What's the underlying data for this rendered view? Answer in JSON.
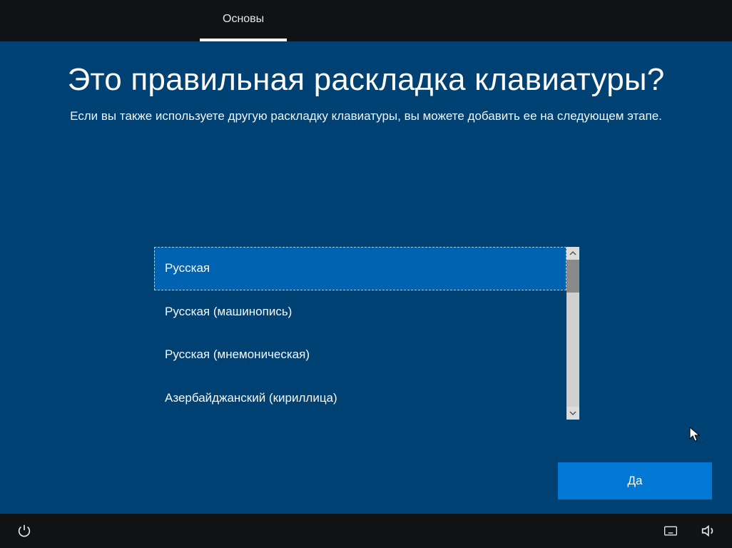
{
  "header": {
    "tab_label": "Основы"
  },
  "main": {
    "title": "Это правильная раскладка клавиатуры?",
    "subtitle": "Если вы также используете другую раскладку клавиатуры, вы можете добавить ее на следующем этапе."
  },
  "keyboard_list": {
    "items": [
      {
        "label": "Русская",
        "selected": true
      },
      {
        "label": "Русская (машинопись)",
        "selected": false
      },
      {
        "label": "Русская (мнемоническая)",
        "selected": false
      },
      {
        "label": "Азербайджанский (кириллица)",
        "selected": false
      }
    ]
  },
  "actions": {
    "confirm_label": "Да"
  },
  "icons": {
    "power": "power-icon",
    "keyboard": "keyboard-icon",
    "sound": "sound-icon"
  }
}
